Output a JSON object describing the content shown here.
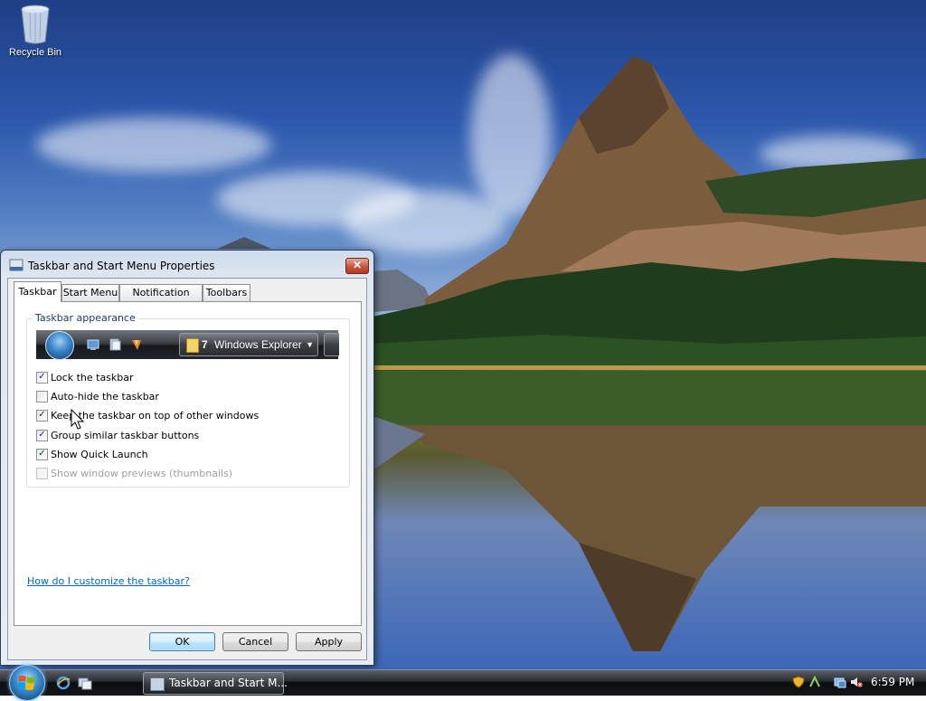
{
  "desktop": {
    "icons": [
      {
        "label": "Recycle Bin",
        "icon": "recycle-bin-icon"
      }
    ]
  },
  "dialog": {
    "title": "Taskbar and Start Menu Properties",
    "close_label": "✕",
    "tabs": [
      {
        "label": "Taskbar",
        "active": true
      },
      {
        "label": "Start Menu",
        "active": false
      },
      {
        "label": "Notification Area",
        "active": false
      },
      {
        "label": "Toolbars",
        "active": false
      }
    ],
    "group_label": "Taskbar appearance",
    "preview": {
      "button_count": "7",
      "button_label": "Windows Explorer"
    },
    "options": [
      {
        "label": "Lock the taskbar",
        "checked": true,
        "enabled": true
      },
      {
        "label": "Auto-hide the taskbar",
        "checked": false,
        "enabled": true
      },
      {
        "label": "Keep the taskbar on top of other windows",
        "checked": true,
        "enabled": true
      },
      {
        "label": "Group similar taskbar buttons",
        "checked": true,
        "enabled": true
      },
      {
        "label": "Show Quick Launch",
        "checked": true,
        "enabled": true
      },
      {
        "label": "Show window previews (thumbnails)",
        "checked": false,
        "enabled": false
      }
    ],
    "help_link": "How do I customize the taskbar?",
    "buttons": {
      "ok": "OK",
      "cancel": "Cancel",
      "apply": "Apply"
    }
  },
  "taskbar": {
    "task_button_label": "Taskbar and Start M...",
    "clock": "6:59 PM",
    "tray_icons": [
      "security-shield-icon",
      "network-icon",
      "safely-remove-icon",
      "volume-muted-icon"
    ]
  },
  "colors": {
    "link": "#0066cc",
    "group_label": "#1e395b",
    "close_button": "#c8553f"
  }
}
